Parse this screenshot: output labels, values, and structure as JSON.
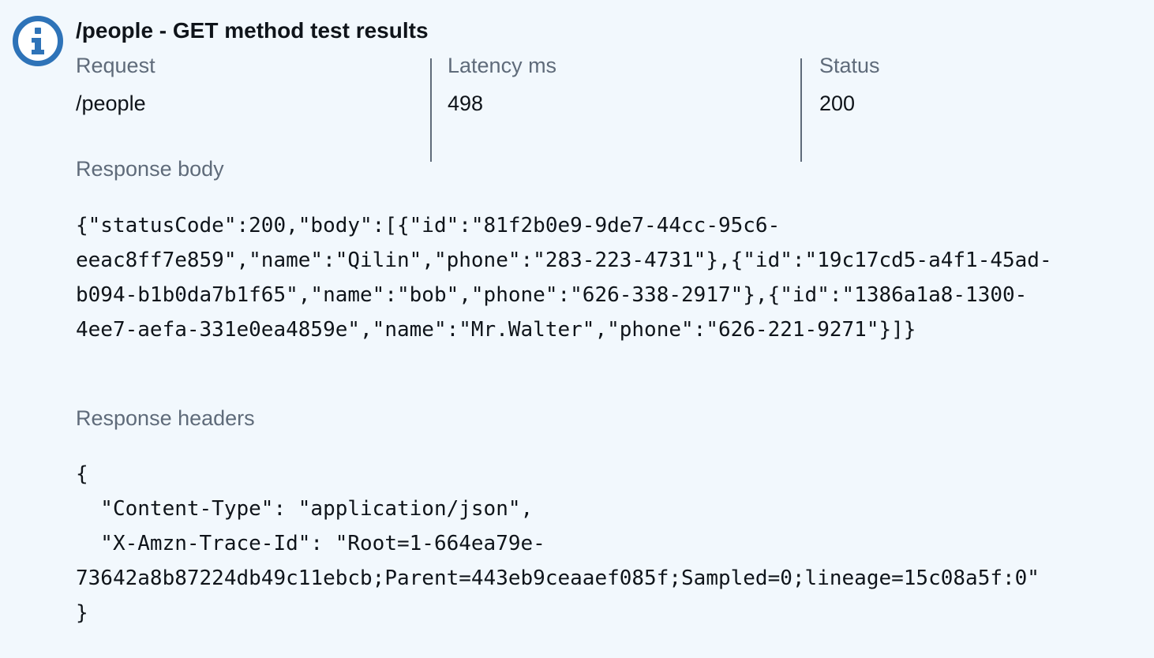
{
  "alert": {
    "title": "/people - GET method test results",
    "icon": "info-icon",
    "accent_color": "#2e73b8"
  },
  "summary": {
    "request_label": "Request",
    "request_value": "/people",
    "latency_label": "Latency ms",
    "latency_value": "498",
    "status_label": "Status",
    "status_value": "200"
  },
  "response_body": {
    "label": "Response body",
    "lines": [
      "{\"statusCode\":200,\"body\":[{\"id\":\"81f2b0e9-9de7-44cc-95c6-",
      "eeac8ff7e859\",\"name\":\"Qilin\",\"phone\":\"283-223-4731\"},{\"id\":\"19c17cd5-a4f1-45ad-",
      "b094-b1b0da7b1f65\",\"name\":\"bob\",\"phone\":\"626-338-2917\"},{\"id\":\"1386a1a8-1300-",
      "4ee7-aefa-331e0ea4859e\",\"name\":\"Mr.Walter\",\"phone\":\"626-221-9271\"}]}"
    ]
  },
  "response_headers": {
    "label": "Response headers",
    "lines": [
      "{",
      "  \"Content-Type\": \"application/json\",",
      "  \"X-Amzn-Trace-Id\": \"Root=1-664ea79e-",
      "73642a8b87224db49c11ebcb;Parent=443eb9ceaaef085f;Sampled=0;lineage=15c08a5f:0\"",
      "}"
    ]
  }
}
